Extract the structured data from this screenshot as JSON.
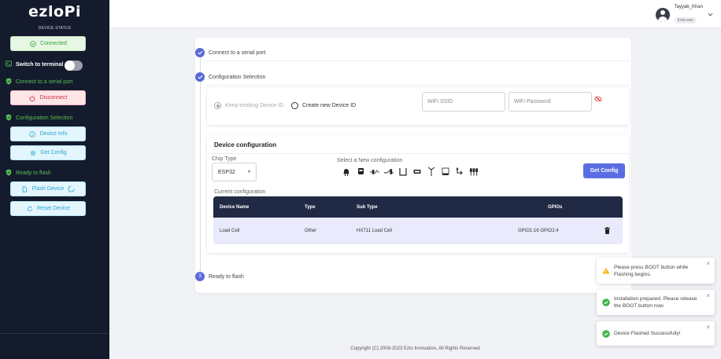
{
  "sidebar": {
    "logo": "ezloPi",
    "device_status_label": "DEVICE STATUS",
    "connected_label": "Connected",
    "switch_to_terminal_label": "Switch to terminal",
    "connect_serial_label": "Connect to a serial port",
    "disconnect_label": "Disconnect",
    "configuration_selection_label": "Configuration Selection",
    "device_info_label": "Device Info",
    "get_config_label": "Get Config",
    "ready_to_flash_label": "Ready to flash",
    "flash_device_label": "Flash Device",
    "reset_device_label": "Reset Device"
  },
  "topbar": {
    "username": "Tayyab_Khan",
    "role": "End-user"
  },
  "steps": {
    "step1": "Connect to a serial port",
    "step2": "Configuration Selection",
    "step3_number": "3",
    "step3": "Ready to flash"
  },
  "config_selection": {
    "keep_existing_label": "Keep existing Device ID",
    "create_new_label": "Create new Device ID",
    "wifi_ssid_placeholder": "WiFi SSID",
    "wifi_password_placeholder": "WiFi Password"
  },
  "device_configuration": {
    "title": "Device configuration",
    "chip_type_label": "Chip Type",
    "chip_type_value": "ESP32",
    "select_new_label": "Select a New configuration",
    "get_config_button": "Get Config",
    "current_configuration_label": "Current configuration",
    "table": {
      "headers": [
        "Device Name",
        "Type",
        "Sub Type",
        "GPIOs"
      ],
      "rows": [
        {
          "device_name": "Load Cell",
          "type": "Other",
          "sub_type": "HX711 Load Cell",
          "gpios": "GPIO1:16 GPIO2:4"
        }
      ]
    },
    "icons": [
      "led-icon",
      "interface-icon",
      "relay-icon",
      "switch-icon",
      "sensor-icon",
      "pwm-icon",
      "antenna-icon",
      "load-cell-icon",
      "transfer-icon",
      "pin-header-icon"
    ]
  },
  "toasts": [
    {
      "type": "warning",
      "text": "Please press BOOT button while Flashing begins."
    },
    {
      "type": "success",
      "text": "Installation prepared. Please release the BOOT button now."
    },
    {
      "type": "success",
      "text": "Device Flashed Successfully!"
    }
  ],
  "footer": {
    "copyright": "Copyright (C) 2008-2023 Ezlo Innovation, All Rights Reserved"
  },
  "colors": {
    "sidebar_bg": "#141b2d",
    "accent": "#5b6ee1",
    "success": "#3aa53a",
    "danger": "#d0303f",
    "info": "#2aa3d6",
    "table_header": "#212a45"
  }
}
